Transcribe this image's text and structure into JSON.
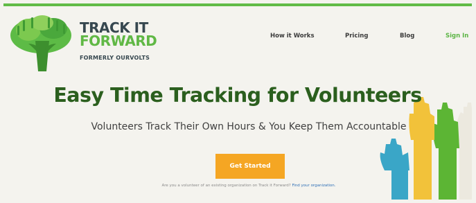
{
  "brand": {
    "line1": "TRACK IT",
    "line2": "FORWARD",
    "sub": "FORMERLY OURVOLTS"
  },
  "nav": {
    "how_it_works": "How it Works",
    "pricing": "Pricing",
    "blog": "Blog",
    "sign_in": "Sign In"
  },
  "hero": {
    "title": "Easy Time Tracking for Volunteers",
    "subtitle": "Volunteers Track Their Own Hours & You Keep Them Accountable",
    "cta": "Get Started",
    "footnote_text": "Are you a volunteer of an existing organization on Track it Forward?",
    "footnote_link": "Find your organization."
  },
  "colors": {
    "accent_green": "#60b845",
    "dark_green": "#2b5f1e",
    "cta_orange": "#f5a623",
    "link_blue": "#2e6fb6"
  },
  "icons": [
    "tree-of-hands-logo",
    "raised-hands-illustration"
  ]
}
